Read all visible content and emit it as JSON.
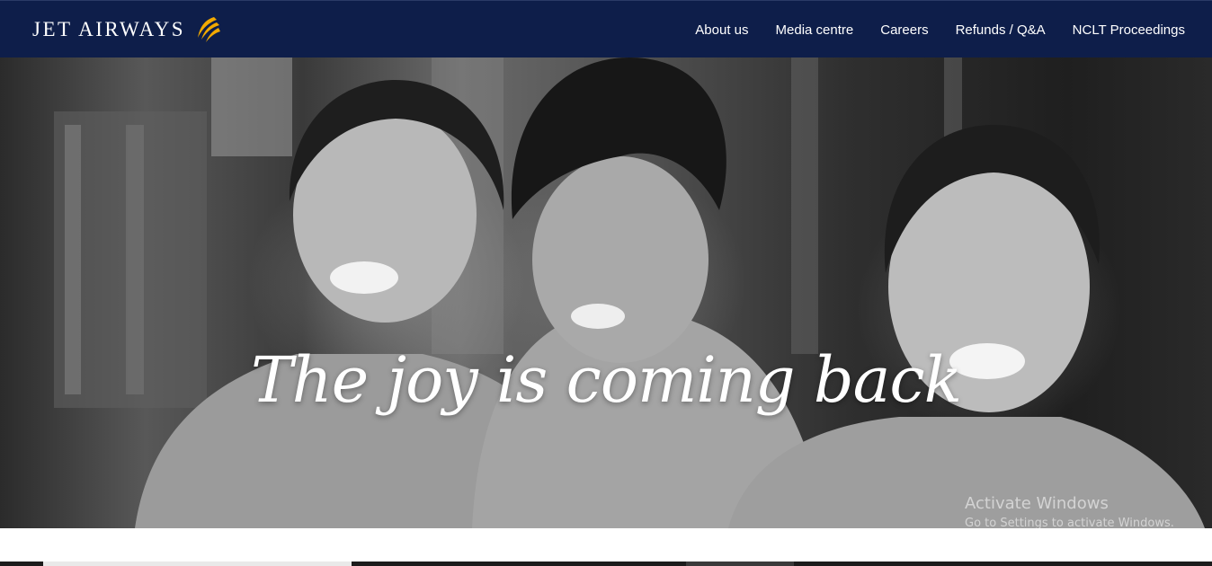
{
  "brand": {
    "name": "JET AIRWAYS",
    "mark_color": "#f2a900"
  },
  "nav": {
    "items": [
      {
        "label": "About us"
      },
      {
        "label": "Media centre"
      },
      {
        "label": "Careers"
      },
      {
        "label": "Refunds / Q&A"
      },
      {
        "label": "NCLT Proceedings"
      }
    ]
  },
  "hero": {
    "headline": "The joy is coming back",
    "image_alt_subject": "three smiling flight attendants in black and white"
  },
  "os_watermark": {
    "line1": "Activate Windows",
    "line2": "Go to Settings to activate Windows."
  },
  "colors": {
    "header_bg": "#0e1e4a",
    "nav_text": "#ffffff"
  }
}
